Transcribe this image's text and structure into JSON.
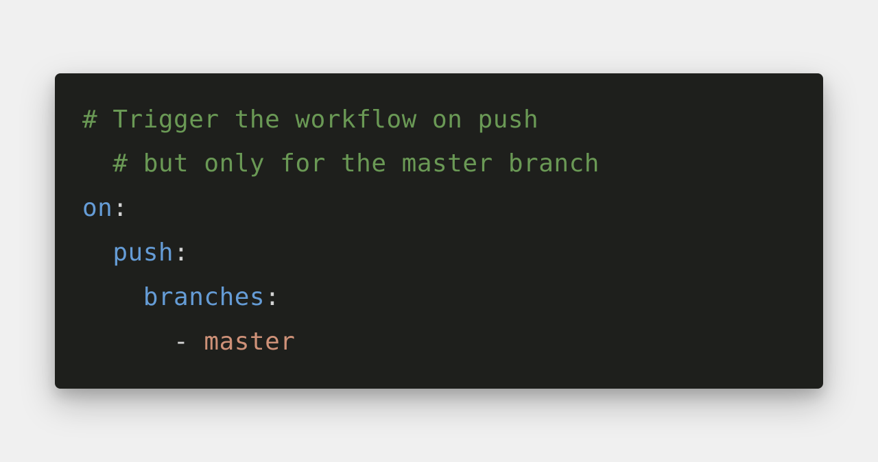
{
  "code": {
    "line1_comment": "# Trigger the workflow on push",
    "line2_indent": "  ",
    "line2_comment": "# but only for the master branch",
    "line3_key": "on",
    "line3_colon": ":",
    "line4_indent": "  ",
    "line4_key": "push",
    "line4_colon": ":",
    "line5_indent": "    ",
    "line5_key": "branches",
    "line5_colon": ":",
    "line6_indent": "      ",
    "line6_dash": "- ",
    "line6_value": "master"
  }
}
